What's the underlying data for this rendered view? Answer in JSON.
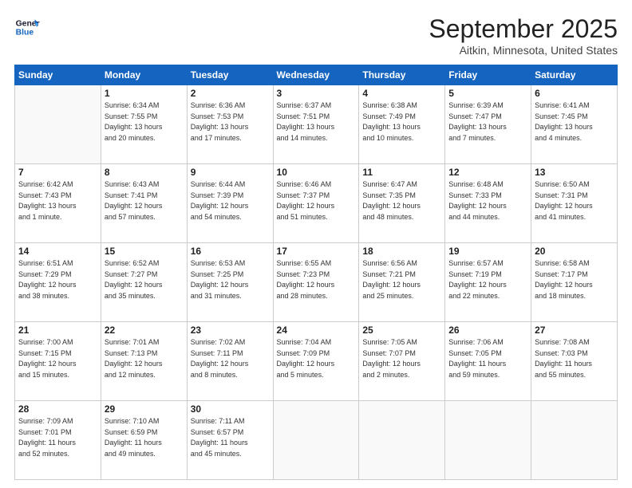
{
  "header": {
    "logo_line1": "General",
    "logo_line2": "Blue",
    "title": "September 2025",
    "subtitle": "Aitkin, Minnesota, United States"
  },
  "days_of_week": [
    "Sunday",
    "Monday",
    "Tuesday",
    "Wednesday",
    "Thursday",
    "Friday",
    "Saturday"
  ],
  "weeks": [
    [
      {
        "day": "",
        "info": ""
      },
      {
        "day": "1",
        "info": "Sunrise: 6:34 AM\nSunset: 7:55 PM\nDaylight: 13 hours\nand 20 minutes."
      },
      {
        "day": "2",
        "info": "Sunrise: 6:36 AM\nSunset: 7:53 PM\nDaylight: 13 hours\nand 17 minutes."
      },
      {
        "day": "3",
        "info": "Sunrise: 6:37 AM\nSunset: 7:51 PM\nDaylight: 13 hours\nand 14 minutes."
      },
      {
        "day": "4",
        "info": "Sunrise: 6:38 AM\nSunset: 7:49 PM\nDaylight: 13 hours\nand 10 minutes."
      },
      {
        "day": "5",
        "info": "Sunrise: 6:39 AM\nSunset: 7:47 PM\nDaylight: 13 hours\nand 7 minutes."
      },
      {
        "day": "6",
        "info": "Sunrise: 6:41 AM\nSunset: 7:45 PM\nDaylight: 13 hours\nand 4 minutes."
      }
    ],
    [
      {
        "day": "7",
        "info": "Sunrise: 6:42 AM\nSunset: 7:43 PM\nDaylight: 13 hours\nand 1 minute."
      },
      {
        "day": "8",
        "info": "Sunrise: 6:43 AM\nSunset: 7:41 PM\nDaylight: 12 hours\nand 57 minutes."
      },
      {
        "day": "9",
        "info": "Sunrise: 6:44 AM\nSunset: 7:39 PM\nDaylight: 12 hours\nand 54 minutes."
      },
      {
        "day": "10",
        "info": "Sunrise: 6:46 AM\nSunset: 7:37 PM\nDaylight: 12 hours\nand 51 minutes."
      },
      {
        "day": "11",
        "info": "Sunrise: 6:47 AM\nSunset: 7:35 PM\nDaylight: 12 hours\nand 48 minutes."
      },
      {
        "day": "12",
        "info": "Sunrise: 6:48 AM\nSunset: 7:33 PM\nDaylight: 12 hours\nand 44 minutes."
      },
      {
        "day": "13",
        "info": "Sunrise: 6:50 AM\nSunset: 7:31 PM\nDaylight: 12 hours\nand 41 minutes."
      }
    ],
    [
      {
        "day": "14",
        "info": "Sunrise: 6:51 AM\nSunset: 7:29 PM\nDaylight: 12 hours\nand 38 minutes."
      },
      {
        "day": "15",
        "info": "Sunrise: 6:52 AM\nSunset: 7:27 PM\nDaylight: 12 hours\nand 35 minutes."
      },
      {
        "day": "16",
        "info": "Sunrise: 6:53 AM\nSunset: 7:25 PM\nDaylight: 12 hours\nand 31 minutes."
      },
      {
        "day": "17",
        "info": "Sunrise: 6:55 AM\nSunset: 7:23 PM\nDaylight: 12 hours\nand 28 minutes."
      },
      {
        "day": "18",
        "info": "Sunrise: 6:56 AM\nSunset: 7:21 PM\nDaylight: 12 hours\nand 25 minutes."
      },
      {
        "day": "19",
        "info": "Sunrise: 6:57 AM\nSunset: 7:19 PM\nDaylight: 12 hours\nand 22 minutes."
      },
      {
        "day": "20",
        "info": "Sunrise: 6:58 AM\nSunset: 7:17 PM\nDaylight: 12 hours\nand 18 minutes."
      }
    ],
    [
      {
        "day": "21",
        "info": "Sunrise: 7:00 AM\nSunset: 7:15 PM\nDaylight: 12 hours\nand 15 minutes."
      },
      {
        "day": "22",
        "info": "Sunrise: 7:01 AM\nSunset: 7:13 PM\nDaylight: 12 hours\nand 12 minutes."
      },
      {
        "day": "23",
        "info": "Sunrise: 7:02 AM\nSunset: 7:11 PM\nDaylight: 12 hours\nand 8 minutes."
      },
      {
        "day": "24",
        "info": "Sunrise: 7:04 AM\nSunset: 7:09 PM\nDaylight: 12 hours\nand 5 minutes."
      },
      {
        "day": "25",
        "info": "Sunrise: 7:05 AM\nSunset: 7:07 PM\nDaylight: 12 hours\nand 2 minutes."
      },
      {
        "day": "26",
        "info": "Sunrise: 7:06 AM\nSunset: 7:05 PM\nDaylight: 11 hours\nand 59 minutes."
      },
      {
        "day": "27",
        "info": "Sunrise: 7:08 AM\nSunset: 7:03 PM\nDaylight: 11 hours\nand 55 minutes."
      }
    ],
    [
      {
        "day": "28",
        "info": "Sunrise: 7:09 AM\nSunset: 7:01 PM\nDaylight: 11 hours\nand 52 minutes."
      },
      {
        "day": "29",
        "info": "Sunrise: 7:10 AM\nSunset: 6:59 PM\nDaylight: 11 hours\nand 49 minutes."
      },
      {
        "day": "30",
        "info": "Sunrise: 7:11 AM\nSunset: 6:57 PM\nDaylight: 11 hours\nand 45 minutes."
      },
      {
        "day": "",
        "info": ""
      },
      {
        "day": "",
        "info": ""
      },
      {
        "day": "",
        "info": ""
      },
      {
        "day": "",
        "info": ""
      }
    ]
  ]
}
